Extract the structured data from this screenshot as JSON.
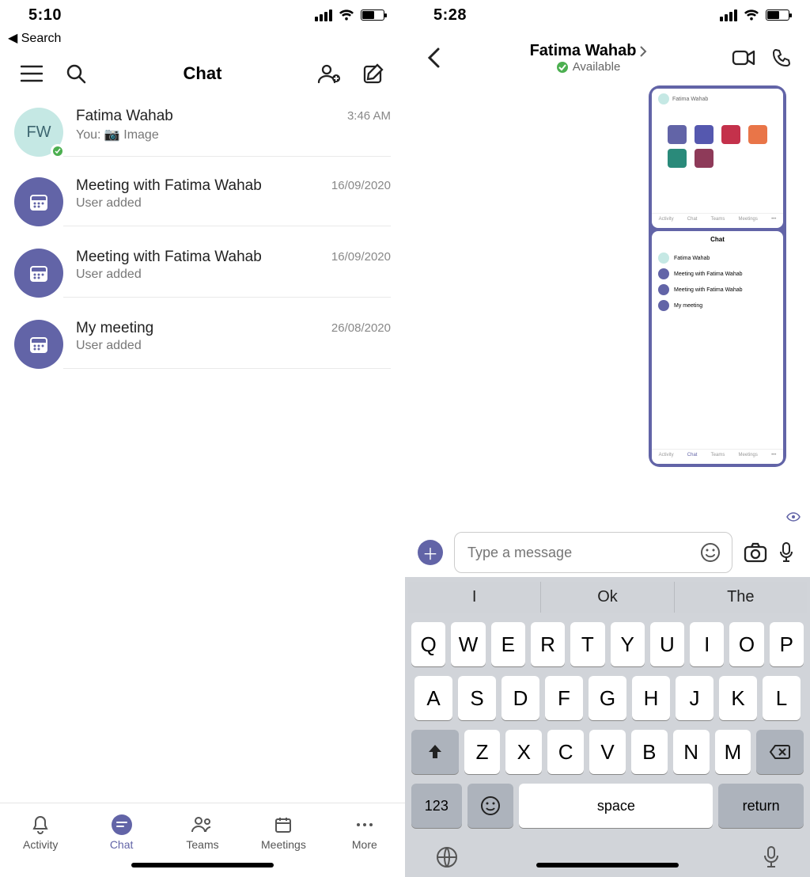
{
  "left": {
    "status_time": "5:10",
    "breadcrumb": "◀ Search",
    "header_title": "Chat",
    "chats": [
      {
        "name": "Fatima Wahab",
        "sub": "You: 📷 Image",
        "meta": "3:46 AM",
        "avatar_text": "FW",
        "type": "person"
      },
      {
        "name": "Meeting with Fatima Wahab",
        "sub": "User added",
        "meta": "16/09/2020",
        "type": "meeting"
      },
      {
        "name": "Meeting with Fatima Wahab",
        "sub": "User added",
        "meta": "16/09/2020",
        "type": "meeting"
      },
      {
        "name": "My meeting",
        "sub": "User added",
        "meta": "26/08/2020",
        "type": "meeting"
      }
    ],
    "tabs": [
      {
        "label": "Activity"
      },
      {
        "label": "Chat"
      },
      {
        "label": "Teams"
      },
      {
        "label": "Meetings"
      },
      {
        "label": "More"
      }
    ],
    "active_tab": "Chat"
  },
  "right": {
    "status_time": "5:28",
    "contact_name": "Fatima Wahab",
    "contact_status": "Available",
    "compose_placeholder": "Type a message",
    "suggestions": [
      "I",
      "Ok",
      "The"
    ],
    "kbd": {
      "row1": [
        "Q",
        "W",
        "E",
        "R",
        "T",
        "Y",
        "U",
        "I",
        "O",
        "P"
      ],
      "row2": [
        "A",
        "S",
        "D",
        "F",
        "G",
        "H",
        "J",
        "K",
        "L"
      ],
      "row3": [
        "Z",
        "X",
        "C",
        "V",
        "B",
        "N",
        "M"
      ],
      "num_key": "123",
      "space": "space",
      "return": "return"
    }
  }
}
